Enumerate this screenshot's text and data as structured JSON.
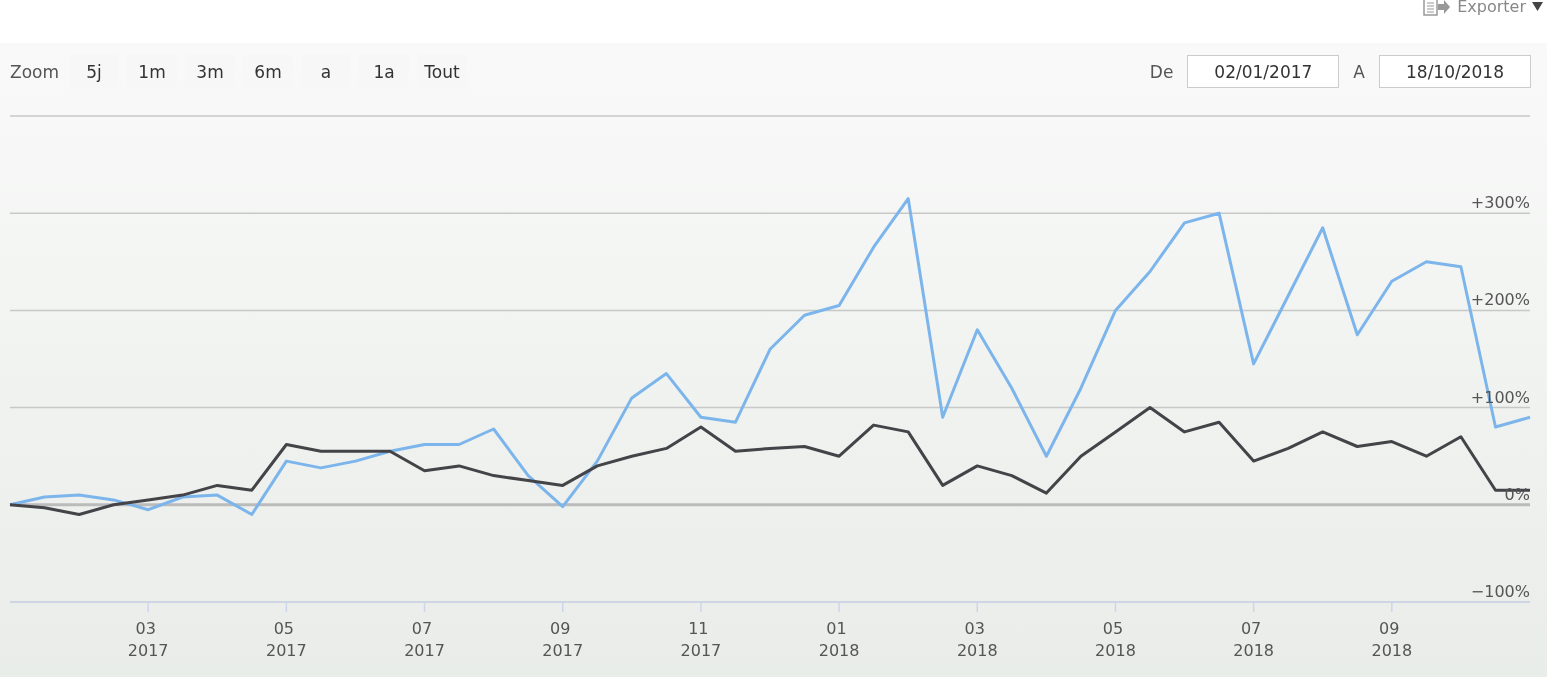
{
  "export_menu": {
    "label": "Exporter"
  },
  "range_selector": {
    "label": "Zoom",
    "buttons": [
      {
        "label": "5j",
        "selected": false
      },
      {
        "label": "1m",
        "selected": false
      },
      {
        "label": "3m",
        "selected": false
      },
      {
        "label": "6m",
        "selected": false
      },
      {
        "label": "a",
        "selected": false
      },
      {
        "label": "1a",
        "selected": false
      },
      {
        "label": "Tout",
        "selected": false
      }
    ]
  },
  "date_range": {
    "from_label": "De",
    "from": "02/01/2017",
    "to_label": "A",
    "to": "18/10/2018"
  },
  "chart": {
    "chart_data": {
      "type": "line",
      "categories": [
        null,
        null,
        null,
        null,
        "03 2017",
        null,
        null,
        null,
        "05 2017",
        null,
        null,
        null,
        "07 2017",
        null,
        null,
        null,
        "09 2017",
        null,
        null,
        null,
        "11 2017",
        null,
        null,
        null,
        "01 2018",
        null,
        null,
        null,
        "03 2018",
        null,
        null,
        null,
        "05 2018",
        null,
        null,
        null,
        "07 2018",
        null,
        null,
        null,
        "09 2018",
        null,
        null,
        null,
        null
      ],
      "series": [
        {
          "color": "#7cb5ec",
          "values": [
            0,
            8,
            10,
            5,
            -5,
            8,
            10,
            -10,
            45,
            38,
            45,
            55,
            62,
            62,
            78,
            30,
            -2,
            45,
            110,
            135,
            90,
            85,
            160,
            195,
            205,
            265,
            315,
            90,
            180,
            120,
            50,
            120,
            200,
            240,
            290,
            300,
            145,
            215,
            285,
            175,
            230,
            250,
            245,
            80,
            90
          ]
        },
        {
          "color": "#434348",
          "values": [
            0,
            -3,
            -10,
            0,
            5,
            10,
            20,
            15,
            62,
            55,
            55,
            55,
            35,
            40,
            30,
            25,
            20,
            40,
            50,
            58,
            80,
            55,
            58,
            60,
            50,
            82,
            75,
            20,
            40,
            30,
            12,
            50,
            75,
            100,
            75,
            85,
            45,
            58,
            75,
            60,
            65,
            50,
            70,
            15,
            15
          ]
        }
      ],
      "ylim": [
        -100,
        400
      ],
      "grid": true,
      "yticks": [
        {
          "value": -100,
          "label": "−100%"
        },
        {
          "value": 0,
          "label": "0%"
        },
        {
          "value": 100,
          "label": "+100%"
        },
        {
          "value": 200,
          "label": "+200%"
        },
        {
          "value": 300,
          "label": "+300%"
        }
      ]
    }
  }
}
